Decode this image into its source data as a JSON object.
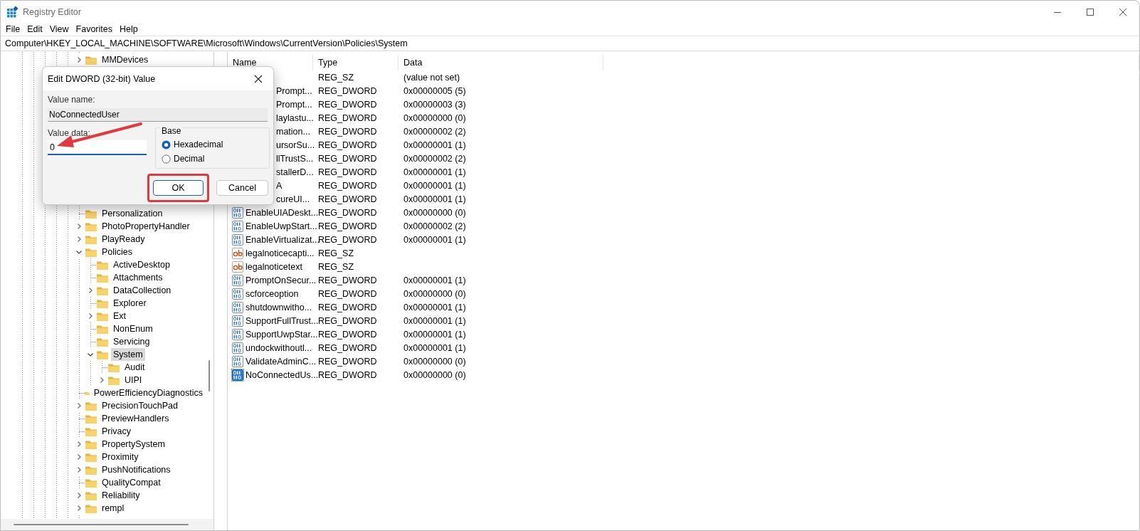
{
  "window": {
    "title": "Registry Editor"
  },
  "menu": [
    "File",
    "Edit",
    "View",
    "Favorites",
    "Help"
  ],
  "address": "Computer\\HKEY_LOCAL_MACHINE\\SOFTWARE\\Microsoft\\Windows\\CurrentVersion\\Policies\\System",
  "tree": {
    "items": [
      {
        "label": "MMDevices",
        "kind": "node",
        "expanded": false,
        "selected": false
      },
      {
        "label": "Personalization",
        "kind": "leaf",
        "selected": false
      },
      {
        "label": "PhotoPropertyHandler",
        "kind": "node",
        "expanded": false,
        "selected": false
      },
      {
        "label": "PlayReady",
        "kind": "node",
        "expanded": false,
        "selected": false
      },
      {
        "label": "Policies",
        "kind": "node",
        "expanded": true,
        "selected": false,
        "children": [
          {
            "label": "ActiveDesktop",
            "kind": "leaf",
            "selected": false
          },
          {
            "label": "Attachments",
            "kind": "leaf",
            "selected": false
          },
          {
            "label": "DataCollection",
            "kind": "node",
            "expanded": false,
            "selected": false
          },
          {
            "label": "Explorer",
            "kind": "leaf",
            "selected": false
          },
          {
            "label": "Ext",
            "kind": "node",
            "expanded": false,
            "selected": false
          },
          {
            "label": "NonEnum",
            "kind": "leaf",
            "selected": false
          },
          {
            "label": "Servicing",
            "kind": "leaf",
            "selected": false
          },
          {
            "label": "System",
            "kind": "node",
            "expanded": true,
            "selected": true,
            "children": [
              {
                "label": "Audit",
                "kind": "leaf",
                "selected": false
              },
              {
                "label": "UIPI",
                "kind": "node",
                "expanded": false,
                "selected": false
              }
            ]
          }
        ]
      },
      {
        "label": "PowerEfficiencyDiagnostics",
        "kind": "leaf",
        "selected": false
      },
      {
        "label": "PrecisionTouchPad",
        "kind": "node",
        "expanded": false,
        "selected": false
      },
      {
        "label": "PreviewHandlers",
        "kind": "leaf",
        "selected": false
      },
      {
        "label": "Privacy",
        "kind": "leaf",
        "selected": false
      },
      {
        "label": "PropertySystem",
        "kind": "node",
        "expanded": false,
        "selected": false
      },
      {
        "label": "Proximity",
        "kind": "node",
        "expanded": false,
        "selected": false
      },
      {
        "label": "PushNotifications",
        "kind": "node",
        "expanded": false,
        "selected": false
      },
      {
        "label": "QualityCompat",
        "kind": "leaf",
        "selected": false
      },
      {
        "label": "Reliability",
        "kind": "node",
        "expanded": false,
        "selected": false
      },
      {
        "label": "rempl",
        "kind": "node",
        "expanded": false,
        "selected": false
      }
    ]
  },
  "values": {
    "columns": [
      "Name",
      "Type",
      "Data"
    ],
    "rows": [
      {
        "type": "REG_SZ",
        "data": "(value not set)"
      },
      {
        "name": "Prompt...",
        "type": "REG_DWORD",
        "data": "0x00000005 (5)"
      },
      {
        "name": "Prompt...",
        "type": "REG_DWORD",
        "data": "0x00000003 (3)"
      },
      {
        "name": "laylastu...",
        "type": "REG_DWORD",
        "data": "0x00000000 (0)"
      },
      {
        "name": "mation...",
        "type": "REG_DWORD",
        "data": "0x00000002 (2)"
      },
      {
        "name": "ursorSu...",
        "type": "REG_DWORD",
        "data": "0x00000001 (1)"
      },
      {
        "name": "llTrustS...",
        "type": "REG_DWORD",
        "data": "0x00000002 (2)"
      },
      {
        "name": "stallerD...",
        "type": "REG_DWORD",
        "data": "0x00000001 (1)"
      },
      {
        "name": "A",
        "type": "REG_DWORD",
        "data": "0x00000001 (1)"
      },
      {
        "name": "cureUI...",
        "type": "REG_DWORD",
        "data": "0x00000001 (1)"
      },
      {
        "name": "EnableUIADeskt...",
        "type": "REG_DWORD",
        "data": "0x00000000 (0)",
        "kind": "binary",
        "selected": false
      },
      {
        "name": "EnableUwpStart...",
        "type": "REG_DWORD",
        "data": "0x00000002 (2)",
        "kind": "binary",
        "selected": false
      },
      {
        "name": "EnableVirtualizat...",
        "type": "REG_DWORD",
        "data": "0x00000001 (1)",
        "kind": "binary",
        "selected": false
      },
      {
        "name": "legalnoticecapti...",
        "type": "REG_SZ",
        "kind": "string",
        "selected": false
      },
      {
        "name": "legalnoticetext",
        "type": "REG_SZ",
        "kind": "string",
        "selected": false
      },
      {
        "name": "PromptOnSecur...",
        "type": "REG_DWORD",
        "data": "0x00000001 (1)",
        "kind": "binary",
        "selected": false
      },
      {
        "name": "scforceoption",
        "type": "REG_DWORD",
        "data": "0x00000000 (0)",
        "kind": "binary",
        "selected": false
      },
      {
        "name": "shutdownwitho...",
        "type": "REG_DWORD",
        "data": "0x00000001 (1)",
        "kind": "binary",
        "selected": false
      },
      {
        "name": "SupportFullTrust...",
        "type": "REG_DWORD",
        "data": "0x00000001 (1)",
        "kind": "binary",
        "selected": false
      },
      {
        "name": "SupportUwpStar...",
        "type": "REG_DWORD",
        "data": "0x00000001 (1)",
        "kind": "binary",
        "selected": false
      },
      {
        "name": "undockwithoutl...",
        "type": "REG_DWORD",
        "data": "0x00000001 (1)",
        "kind": "binary",
        "selected": false
      },
      {
        "name": "ValidateAdminC...",
        "type": "REG_DWORD",
        "data": "0x00000000 (0)",
        "kind": "binary",
        "selected": false
      },
      {
        "name": "NoConnectedUs...",
        "type": "REG_DWORD",
        "data": "0x00000000 (0)",
        "kind": "binary",
        "selected": true
      }
    ]
  },
  "dialog": {
    "title": "Edit DWORD (32-bit) Value",
    "value_name_label": "Value name:",
    "value_name": "NoConnectedUser",
    "value_data_label": "Value data:",
    "value_data": "0",
    "base_label": "Base",
    "bases": [
      {
        "label": "Hexadecimal",
        "selected": true
      },
      {
        "label": "Decimal",
        "selected": false
      }
    ],
    "buttons": [
      {
        "label": "OK",
        "default": true,
        "highlighted": true
      },
      {
        "label": "Cancel",
        "default": false,
        "highlighted": false
      }
    ]
  }
}
